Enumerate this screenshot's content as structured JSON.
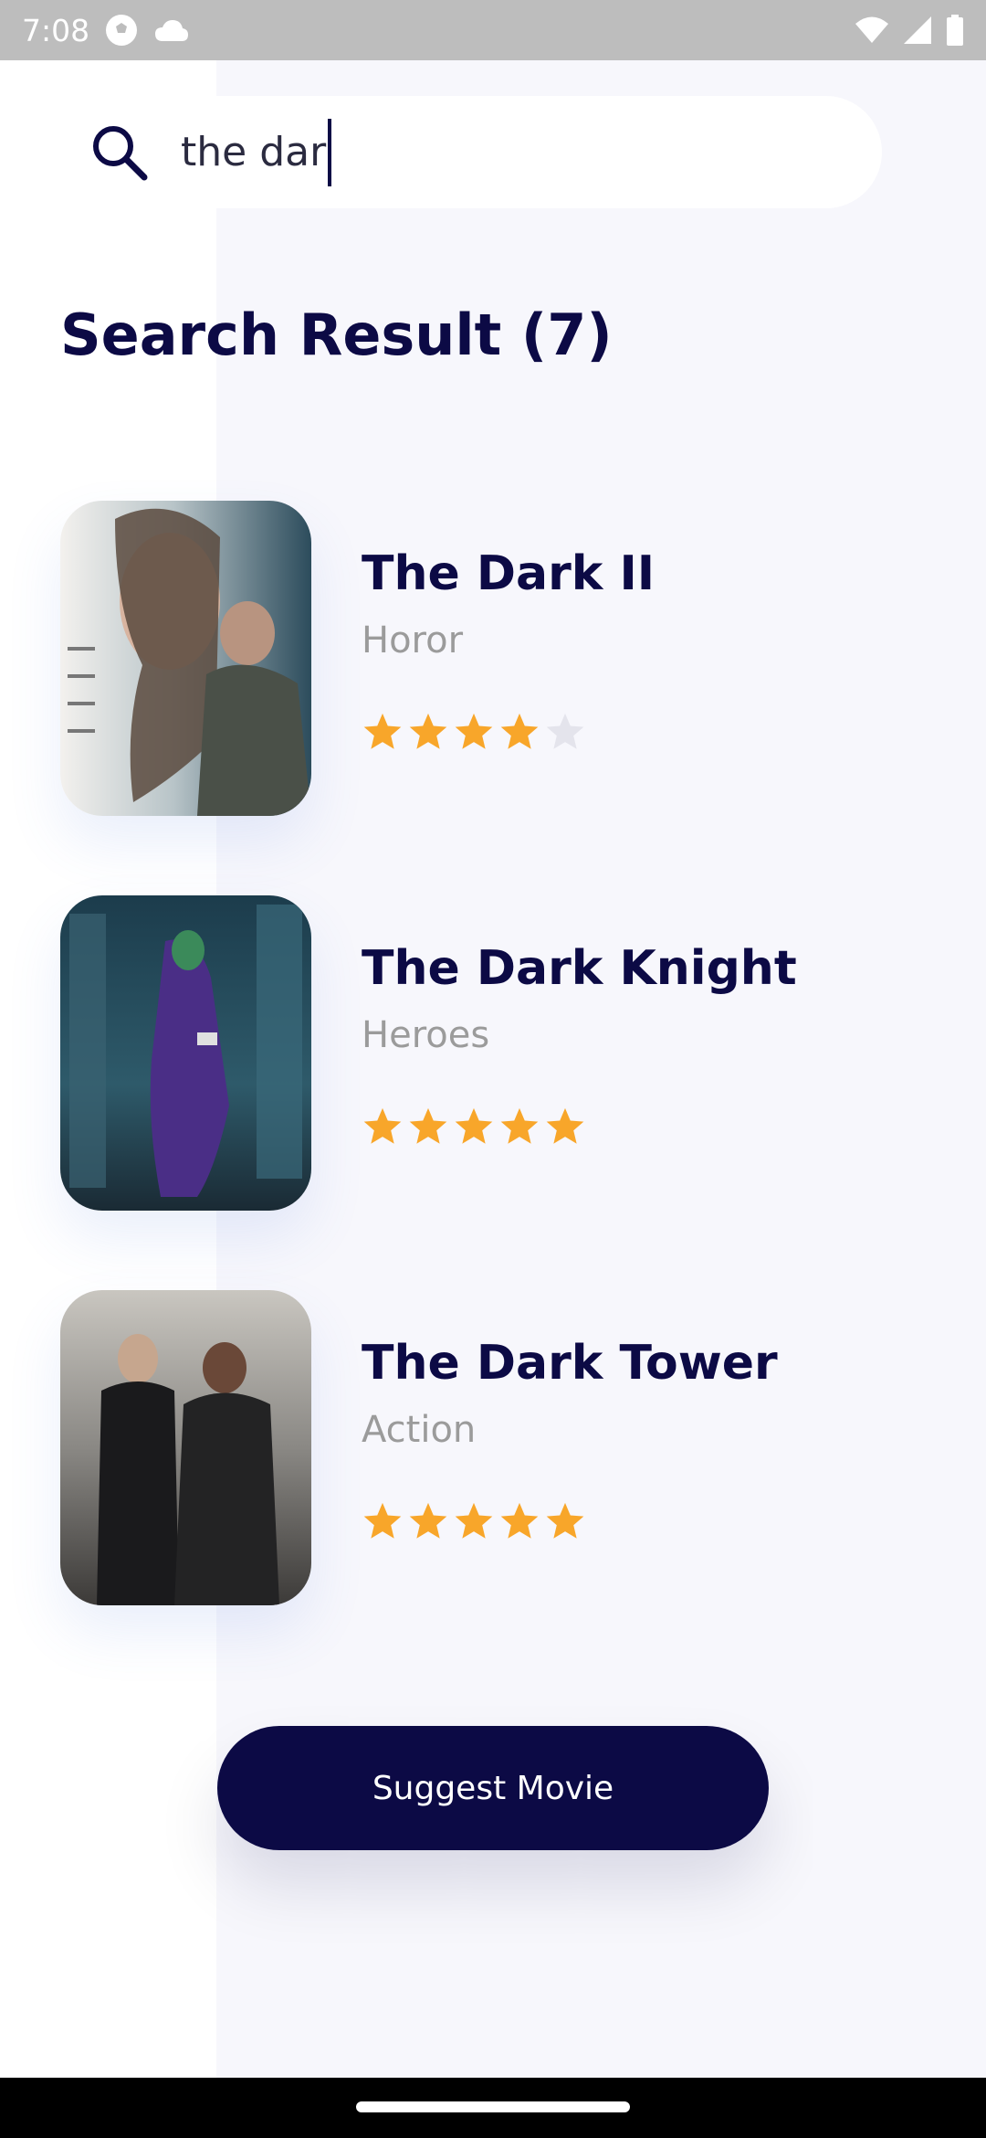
{
  "status_bar": {
    "time": "7:08"
  },
  "search": {
    "value": "the dar"
  },
  "results_title": "Search Result (7)",
  "results": [
    {
      "title": "The Dark II",
      "genre": "Horor",
      "rating": 4
    },
    {
      "title": "The Dark Knight",
      "genre": "Heroes",
      "rating": 5
    },
    {
      "title": "The Dark Tower",
      "genre": "Action",
      "rating": 5
    }
  ],
  "suggest_button": {
    "label": "Suggest Movie"
  },
  "colors": {
    "primary": "#0c0a45",
    "star_active": "#f8a62a",
    "star_inactive": "#e4e4ec",
    "genre_text": "#9b9b9b"
  }
}
